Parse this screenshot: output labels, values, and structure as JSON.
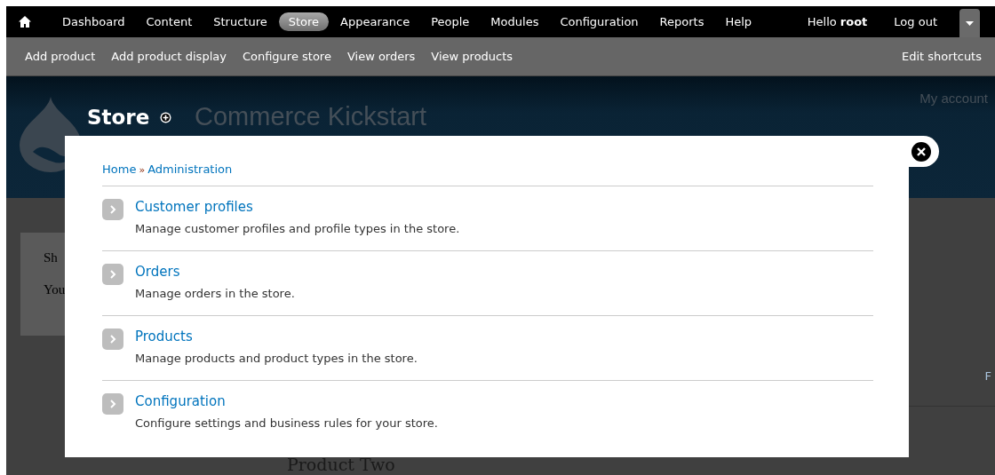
{
  "toolbar": {
    "items": [
      {
        "label": "Dashboard",
        "selected": false
      },
      {
        "label": "Content",
        "selected": false
      },
      {
        "label": "Structure",
        "selected": false
      },
      {
        "label": "Store",
        "selected": true
      },
      {
        "label": "Appearance",
        "selected": false
      },
      {
        "label": "People",
        "selected": false
      },
      {
        "label": "Modules",
        "selected": false
      },
      {
        "label": "Configuration",
        "selected": false
      },
      {
        "label": "Reports",
        "selected": false
      },
      {
        "label": "Help",
        "selected": false
      }
    ],
    "greeting": "Hello **root**",
    "logout": "Log out"
  },
  "shortcuts": {
    "items": [
      "Add product",
      "Add product display",
      "Configure store",
      "View orders",
      "View products"
    ],
    "edit": "Edit shortcuts"
  },
  "header": {
    "title": "Store",
    "site_name": "Commerce Kickstart",
    "account_link": "My account"
  },
  "background": {
    "block_title": "Sh",
    "block_text": "You",
    "link_fragment": "F",
    "heading": "Product Two"
  },
  "modal": {
    "breadcrumb": [
      "Home",
      "Administration"
    ],
    "separator": "»",
    "items": [
      {
        "title": "Customer profiles",
        "description": "Manage customer profiles and profile types in the store."
      },
      {
        "title": "Orders",
        "description": "Manage orders in the store."
      },
      {
        "title": "Products",
        "description": "Manage products and product types in the store."
      },
      {
        "title": "Configuration",
        "description": "Configure settings and business rules for your store."
      }
    ]
  }
}
